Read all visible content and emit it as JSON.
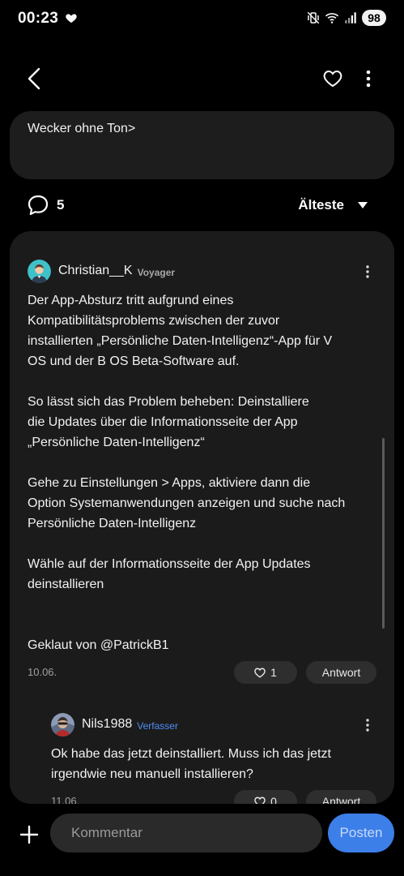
{
  "status_bar": {
    "time": "00:23",
    "battery": "98",
    "icons": [
      "heart-icon",
      "mute-vibrate-icon",
      "wifi-icon",
      "signal-icon",
      "battery-icon"
    ]
  },
  "top_bar": {
    "icons": [
      "back-arrow-icon",
      "heart-outline-icon",
      "more-vertical-icon"
    ]
  },
  "post": {
    "snippet": "Wecker ohne Ton>"
  },
  "comments_bar": {
    "count": "5",
    "sort_label": "Älteste"
  },
  "comments": [
    {
      "username": "Christian__K",
      "rank": "Voyager",
      "paragraphs": [
        "Der App-Absturz tritt aufgrund eines\nKompatibilitätsproblems zwischen der zuvor\ninstallierten „Persönliche Daten-Intelligenz“-App für V\nOS und der B OS Beta-Software auf.",
        "So lässt sich das Problem beheben: Deinstalliere\ndie Updates über die Informationsseite der App\n„Persönliche Daten-Intelligenz“",
        "Gehe zu Einstellungen > Apps, aktiviere dann die\nOption Systemanwendungen anzeigen und suche nach\nPersönliche Daten-Intelligenz",
        "Wähle auf der Informationsseite der App Updates\ndeinstallieren",
        "Geklaut von @PatrickB1"
      ],
      "date": "10.06.",
      "likes": "1",
      "reply_label": "Antwort"
    },
    {
      "username": "Nils1988",
      "rank": "Verfasser",
      "paragraphs": [
        "Ok habe das jetzt deinstalliert. Muss ich das jetzt\nirgendwie neu manuell installieren?"
      ],
      "date": "11.06.",
      "likes": "0",
      "reply_label": "Antwort"
    }
  ],
  "composer": {
    "placeholder": "Kommentar",
    "post_label": "Posten"
  },
  "colors": {
    "background": "#000000",
    "card": "#1d1d1d",
    "accent_blue": "#3d7fe8",
    "author_tag": "#4f8ef7"
  }
}
